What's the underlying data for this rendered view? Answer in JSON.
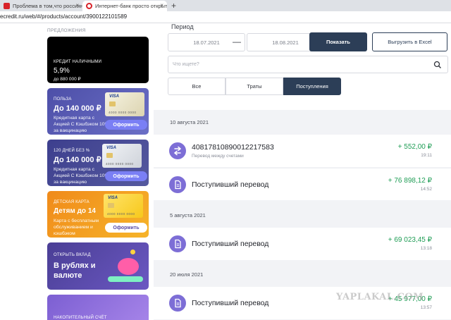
{
  "browser": {
    "tabs": [
      {
        "title": "Проблема в том,что россиян",
        "favicon_color": "#d8232a"
      },
      {
        "title": "Интернет-банк просто открыт",
        "favicon_color": "#d8232a"
      }
    ],
    "close_glyph": "×",
    "new_tab_glyph": "+",
    "url": "ecredit.ru/web/#/products/account/3900122101589"
  },
  "sidebar": {
    "heading": "ПРЕДЛОЖЕНИЯ",
    "promos": [
      {
        "small": "КРЕДИТ НАЛИЧНЫМИ",
        "big": "5,9%",
        "desc": "до 880 000 ₽",
        "bg": "#000000"
      },
      {
        "small": "ПОЛЬЗА",
        "big": "До 140 000 ₽",
        "desc": "Кредитная карта с Акцией С Кэшбэком 10% за вакцинацию",
        "cta": "Оформить",
        "card_brand": "VISA",
        "card_number": "4000 0000 0000",
        "bg": "#5b5fb0"
      },
      {
        "small": "120 ДНЕЙ БЕЗ %",
        "big": "До 140 000 ₽",
        "desc": "Кредитная карта с Акцией С Кэшбэком 10% за вакцинацию",
        "cta": "Оформить",
        "card_brand": "VISA",
        "card_number": "4000 0000 0000",
        "bg": "#454a9c"
      },
      {
        "small": "ДЕТСКАЯ КАРТА",
        "big": "Детям до 14",
        "desc": "Карта с бесплатным обслуживанием и кэшбэком",
        "cta": "Оформить",
        "card_brand": "VISA",
        "card_number": "4000 0000 0000",
        "bg": "#f39a1c"
      },
      {
        "small": "ОТКРЫТЬ ВКЛАД",
        "big": "В рублях и валюте",
        "bg": "#5a4ca5"
      },
      {
        "small": "НАКОПИТЕЛЬНЫЙ СЧЁТ",
        "bg": "#8a6bd8"
      }
    ]
  },
  "filters": {
    "period_label": "Период",
    "date_from": "18.07.2021",
    "dash": "—",
    "date_to": "18.08.2021",
    "show_label": "Показать",
    "export_label": "Выгрузить в Excel",
    "search_placeholder": "Что ищете?",
    "tabs": [
      {
        "label": "Все",
        "active": false
      },
      {
        "label": "Траты",
        "active": false
      },
      {
        "label": "Поступления",
        "active": true
      }
    ]
  },
  "groups": [
    {
      "date": "10 августа 2021",
      "items": [
        {
          "title": "40817810890012217583",
          "subtitle": "Перевод между счетами",
          "amount": "+ 552,00 ₽",
          "time": "19:11",
          "icon": "transfer-arrows-icon"
        },
        {
          "title": "Поступивший перевод",
          "amount": "+ 76 898,12 ₽",
          "time": "14:52",
          "icon": "document-icon"
        }
      ]
    },
    {
      "date": "5 августа 2021",
      "items": [
        {
          "title": "Поступивший перевод",
          "amount": "+ 69 023,45 ₽",
          "time": "13:18",
          "icon": "document-icon"
        }
      ]
    },
    {
      "date": "20 июля 2021",
      "items": [
        {
          "title": "Поступивший перевод",
          "amount": "+ 45 977,00 ₽",
          "time": "13:57",
          "icon": "document-icon"
        }
      ]
    }
  ],
  "colors": {
    "accent": "#7d6ed6",
    "income": "#1f9d55",
    "button_dark": "#2c3e57"
  },
  "watermark": "YAPLAKAL.COM"
}
